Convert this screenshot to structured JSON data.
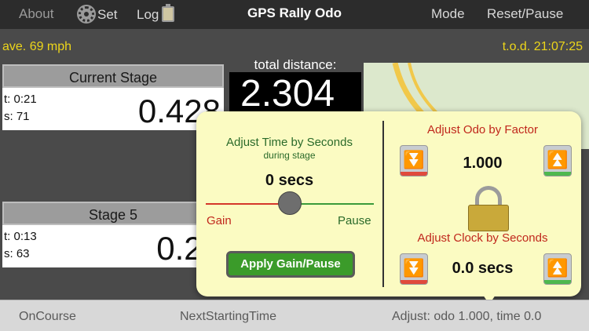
{
  "navbar": {
    "about": "About",
    "set": "Set",
    "log": "Log",
    "title": "GPS Rally Odo",
    "mode": "Mode",
    "reset_pause": "Reset/Pause"
  },
  "status": {
    "average": "ave. 69 mph",
    "time_of_day": "t.o.d. 21:07:25"
  },
  "current_stage": {
    "header": "Current Stage",
    "t": "t: 0:21",
    "s": "s: 71",
    "value": "0.428"
  },
  "total": {
    "label": "total distance:",
    "value": "2.304"
  },
  "stage5": {
    "header": "Stage 5",
    "t": "t: 0:13",
    "s": "s: 63",
    "value": "0.24"
  },
  "popover": {
    "adjust_time_title": "Adjust Time by Seconds",
    "adjust_time_subtitle": "during stage",
    "time_value": "0 secs",
    "gain_label": "Gain",
    "pause_label": "Pause",
    "slider_position": 0.5,
    "apply_button": "Apply Gain/Pause",
    "adjust_odo_title": "Adjust Odo by Factor",
    "odo_value": "1.000",
    "adjust_clock_title": "Adjust Clock by Seconds",
    "clock_value": "0.0 secs"
  },
  "bottombar": {
    "oncourse": "OnCourse",
    "next_starting_time": "NextStartingTime",
    "adjust_status": "Adjust: odo 1.000, time 0.0"
  },
  "colors": {
    "accent_yellow": "#ecd51a",
    "popover_bg": "#fbfbc2",
    "apply_green": "#3b9b2a",
    "gain_red": "#c0271c",
    "pause_green": "#2a6a2a"
  }
}
